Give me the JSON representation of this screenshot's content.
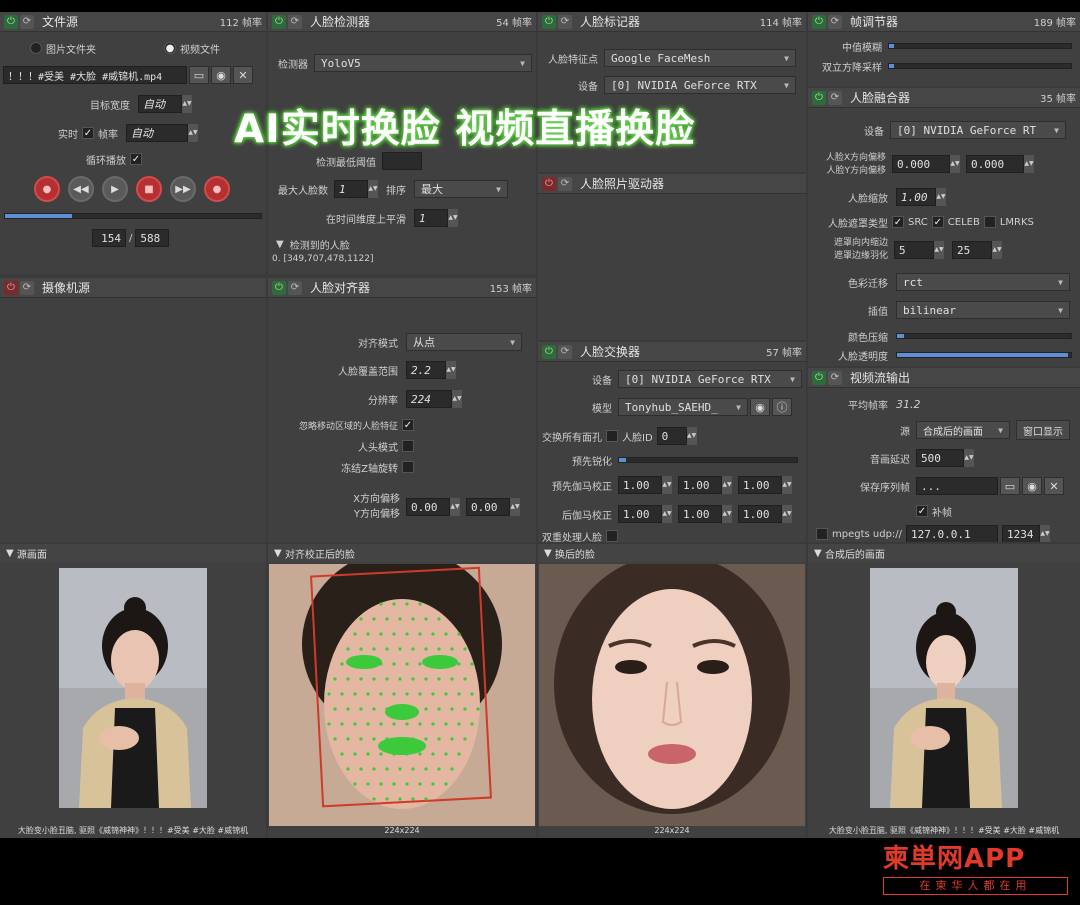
{
  "overlay_title": "AI实时换脸 视频直播换脸",
  "watermark": {
    "brand": "柬単网APP",
    "tagline": "在柬华人都在用"
  },
  "file_source": {
    "title": "文件源",
    "fps": "112 帧率",
    "radio_folder": "图片文件夹",
    "radio_video": "视频文件",
    "path": "！！！#受美 #大脸 #威锦机.mp4",
    "target_width_label": "目标宽度",
    "target_width_value": "自动",
    "realtime_label": "实时",
    "fps_label": "帧率",
    "fps_value": "自动",
    "loop_label": "循环播放",
    "progress": 0.26,
    "frame_current": "154",
    "frame_sep": "/",
    "frame_total": "588"
  },
  "face_detector": {
    "title": "人脸检测器",
    "fps": "54 帧率",
    "detector_label": "检测器",
    "detector_value": "YoloV5",
    "threshold_label": "检测最低阈值",
    "max_faces_label": "最大人脸数",
    "max_faces_value": "1",
    "sort_label": "排序",
    "sort_value": "最大",
    "smooth_label": "在时间维度上平滑",
    "smooth_value": "1",
    "detected_label": "检测到的人脸",
    "detected_value": "0. [349,707,478,1122]"
  },
  "face_marker": {
    "title": "人脸标记器",
    "fps": "114 帧率",
    "marker_label": "人脸特征点",
    "marker_value": "Google FaceMesh",
    "device_label": "设备",
    "device_value": "[0] NVIDIA GeForce RTX"
  },
  "face_animator": {
    "title": "人脸照片驱动器"
  },
  "frame_adjuster": {
    "title": "帧调节器",
    "fps": "189 帧率",
    "median_label": "中值模糊",
    "degrade_label": "双立方降采样"
  },
  "face_merger": {
    "title": "人脸融合器",
    "fps": "35 帧率",
    "device_label": "设备",
    "device_value": "[0] NVIDIA GeForce RT",
    "offset_label_x": "人脸X方向偏移",
    "offset_label_y": "人脸Y方向偏移",
    "offset_x": "0.000",
    "offset_y": "0.000",
    "scale_label": "人脸缩放",
    "scale_value": "1.00",
    "mask_type_label": "人脸遮罩类型",
    "mask_src": "SRC",
    "mask_celeb": "CELEB",
    "mask_lmrks": "LMRKS",
    "erode_label": "遮罩向内缩边",
    "blur_label": "遮罩边缘羽化",
    "erode_value": "5",
    "blur_value": "25",
    "color_transfer_label": "色彩迁移",
    "color_transfer_value": "rct",
    "interp_label": "插值",
    "interp_value": "bilinear",
    "color_compress_label": "颜色压缩",
    "opacity_label": "人脸透明度",
    "opacity": 0.98
  },
  "camera_source": {
    "title": "摄像机源"
  },
  "face_aligner": {
    "title": "人脸对齐器",
    "fps": "153 帧率",
    "mode_label": "对齐模式",
    "mode_value": "从点",
    "coverage_label": "人脸覆盖范围",
    "coverage_value": "2.2",
    "resolution_label": "分辨率",
    "resolution_value": "224",
    "exclude_label": "忽略移动区域的人脸特征",
    "head_mode_label": "人头模式",
    "freeze_label": "冻结Z轴旋转",
    "xoff_label": "X方向偏移",
    "yoff_label": "Y方向偏移",
    "xoff_value": "0.00",
    "yoff_value": "0.00"
  },
  "face_swapper": {
    "title": "人脸交换器",
    "fps": "57 帧率",
    "device_label": "设备",
    "device_value": "[0] NVIDIA GeForce RTX",
    "model_label": "模型",
    "model_value": "Tonyhub_SAEHD_",
    "swap_all_label": "交换所有面孔",
    "face_id_label": "人脸ID",
    "face_id_value": "0",
    "presharpen_label": "预先锐化",
    "pregamma_label": "预先伽马校正",
    "postgamma_label": "后伽马校正",
    "pre_r": "1.00",
    "pre_g": "1.00",
    "pre_b": "1.00",
    "post_r": "1.00",
    "post_g": "1.00",
    "post_b": "1.00",
    "two_pass_label": "双重处理人脸"
  },
  "stream_output": {
    "title": "视频流输出",
    "avg_fps_label": "平均帧率",
    "avg_fps_value": "31.2",
    "source_label": "源",
    "source_value": "合成后的画面",
    "window_button": "窗口显示",
    "delay_label": "音画延迟",
    "delay_value": "500",
    "save_label": "保存序列帧",
    "save_value": "...",
    "fill_label": "补帧",
    "mpegts_label": "mpegts udp://",
    "host": "127.0.0.1",
    "port": "1234"
  },
  "previews": {
    "source": {
      "title": "源画面",
      "caption": "大脸变小脸丑脑, 驱照《威锦神神》！！！#受美 #大脸 #威锦机"
    },
    "aligned": {
      "title": "对齐校正后的脸",
      "caption": "224x224"
    },
    "swapped": {
      "title": "换后的脸",
      "caption": "224x224"
    },
    "merged": {
      "title": "合成后的画面",
      "caption": "大脸变小脸丑脑, 驱照《威锦神神》！！！#受美 #大脸 #威锦机"
    }
  },
  "colors": {
    "accent": "#5c8fd6",
    "power_on": "#2e6b3a",
    "power_off": "#7a2a2a",
    "overlay_glow": "#6fe05a",
    "brand_red": "#e23a2a"
  }
}
